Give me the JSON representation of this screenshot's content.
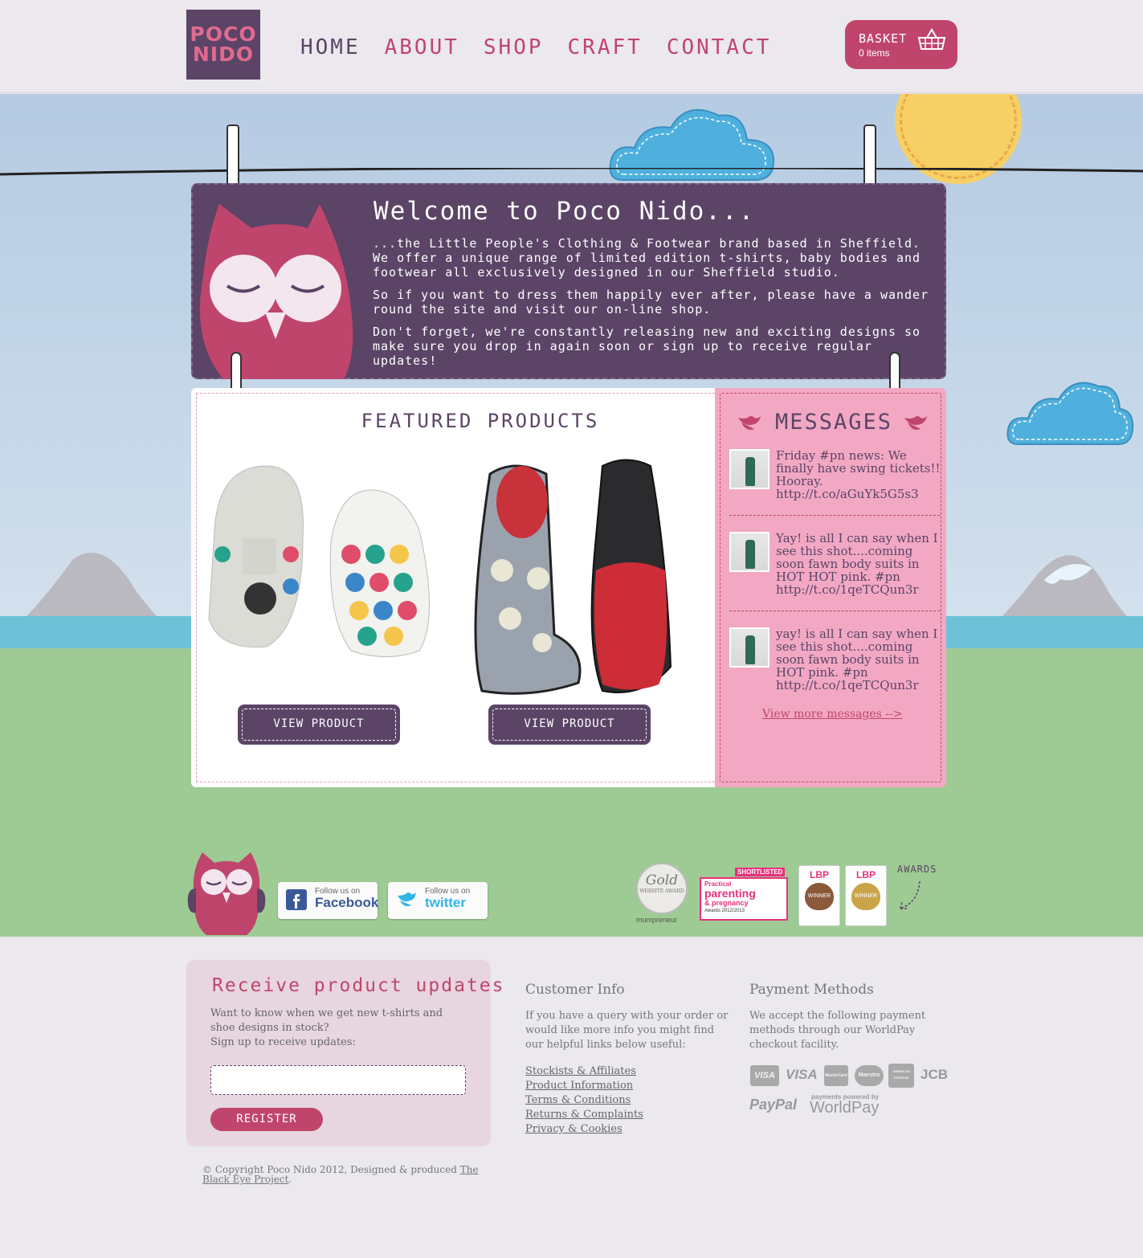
{
  "header": {
    "logo_line1": "POCO",
    "logo_line2": "NIDO",
    "nav": [
      "HOME",
      "ABOUT",
      "SHOP",
      "CRAFT",
      "CONTACT"
    ],
    "basket_label": "BASKET",
    "basket_count": "0 items"
  },
  "welcome": {
    "title": "Welcome to Poco Nido...",
    "p1": "...the Little People's Clothing & Footwear brand based in Sheffield. We offer a unique range of limited edition t-shirts, baby bodies and footwear all exclusively designed in our Sheffield studio.",
    "p2": " So if you want to dress them happily ever after, please have a wander round the site and visit our on-line shop.",
    "p3": " Don't forget, we're constantly releasing new and exciting designs so make sure you drop in again soon or sign up to receive regular updates!"
  },
  "featured": {
    "title": "FEATURED PRODUCTS",
    "products": [
      {
        "button": "VIEW PRODUCT",
        "image": "owl-print-baby-shoes"
      },
      {
        "button": "VIEW PRODUCT",
        "image": "cat-print-wellington-boots"
      }
    ]
  },
  "messages": {
    "title": "MESSAGES",
    "tweets": [
      "Friday #pn news: We finally have swing tickets!! Hooray. http://t.co/aGuYk5G5s3",
      "Yay! is all I can say when I see this shot....coming soon fawn body suits in HOT HOT pink. #pn http://t.co/1qeTCQun3r",
      "yay! is all I can say when I see this shot....coming soon fawn body suits in HOT pink. #pn http://t.co/1qeTCQun3r"
    ],
    "more": "View more messages -->"
  },
  "social": {
    "facebook_small": "Follow us on",
    "facebook_big": "Facebook",
    "twitter_small": "Follow us on",
    "twitter_big": "twitter"
  },
  "awards": {
    "label": "AWARDS",
    "gold_top": "Gold",
    "gold_sub": "WEBSITE AWARD",
    "gold_brand": "mumpreneur",
    "pp_tag": "SHORTLISTED",
    "pp_line1": "Practical",
    "pp_line2": "parenting",
    "pp_line3": "& pregnancy",
    "pp_line4": "Awards 2012/2013",
    "lbp_brand": "LBP",
    "lbp_winner": "WINNER"
  },
  "signup": {
    "title": "Receive product updates",
    "text": "Want to know when we get new t-shirts and shoe designs in stock?",
    "text2": "Sign up to receive updates:",
    "email_placeholder": "",
    "button": "REGISTER"
  },
  "customer_info": {
    "title": "Customer Info",
    "text": "If you have a query with your order or would like more info you might find our helpful links below useful:",
    "links": [
      "Stockists & Affiliates",
      "Product Information",
      "Terms & Conditions",
      "Returns & Complaints",
      "Privacy & Cookies"
    ]
  },
  "payment": {
    "title": "Payment Methods",
    "text": "We accept the following payment methods through our WorldPay checkout facility.",
    "cards": [
      "VISA",
      "VISA",
      "MasterCard",
      "Maestro",
      "AMERICAN EXPRESS",
      "JCB"
    ],
    "paypal": "PayPal",
    "worldpay_small": "payments powered by",
    "worldpay": "WorldPay"
  },
  "footer": {
    "copyright": "© Copyright Poco Nido 2012, Designed & produced ",
    "credit_link": "The Black Eye Project",
    "period": "."
  },
  "colors": {
    "plum": "#5b4466",
    "raspberry": "#c0456d",
    "pink_panel": "#f2a8c3",
    "grass": "#9ecb94",
    "sky": "#c7d8e9",
    "cloud": "#4fb0de",
    "sun": "#f7d065"
  }
}
